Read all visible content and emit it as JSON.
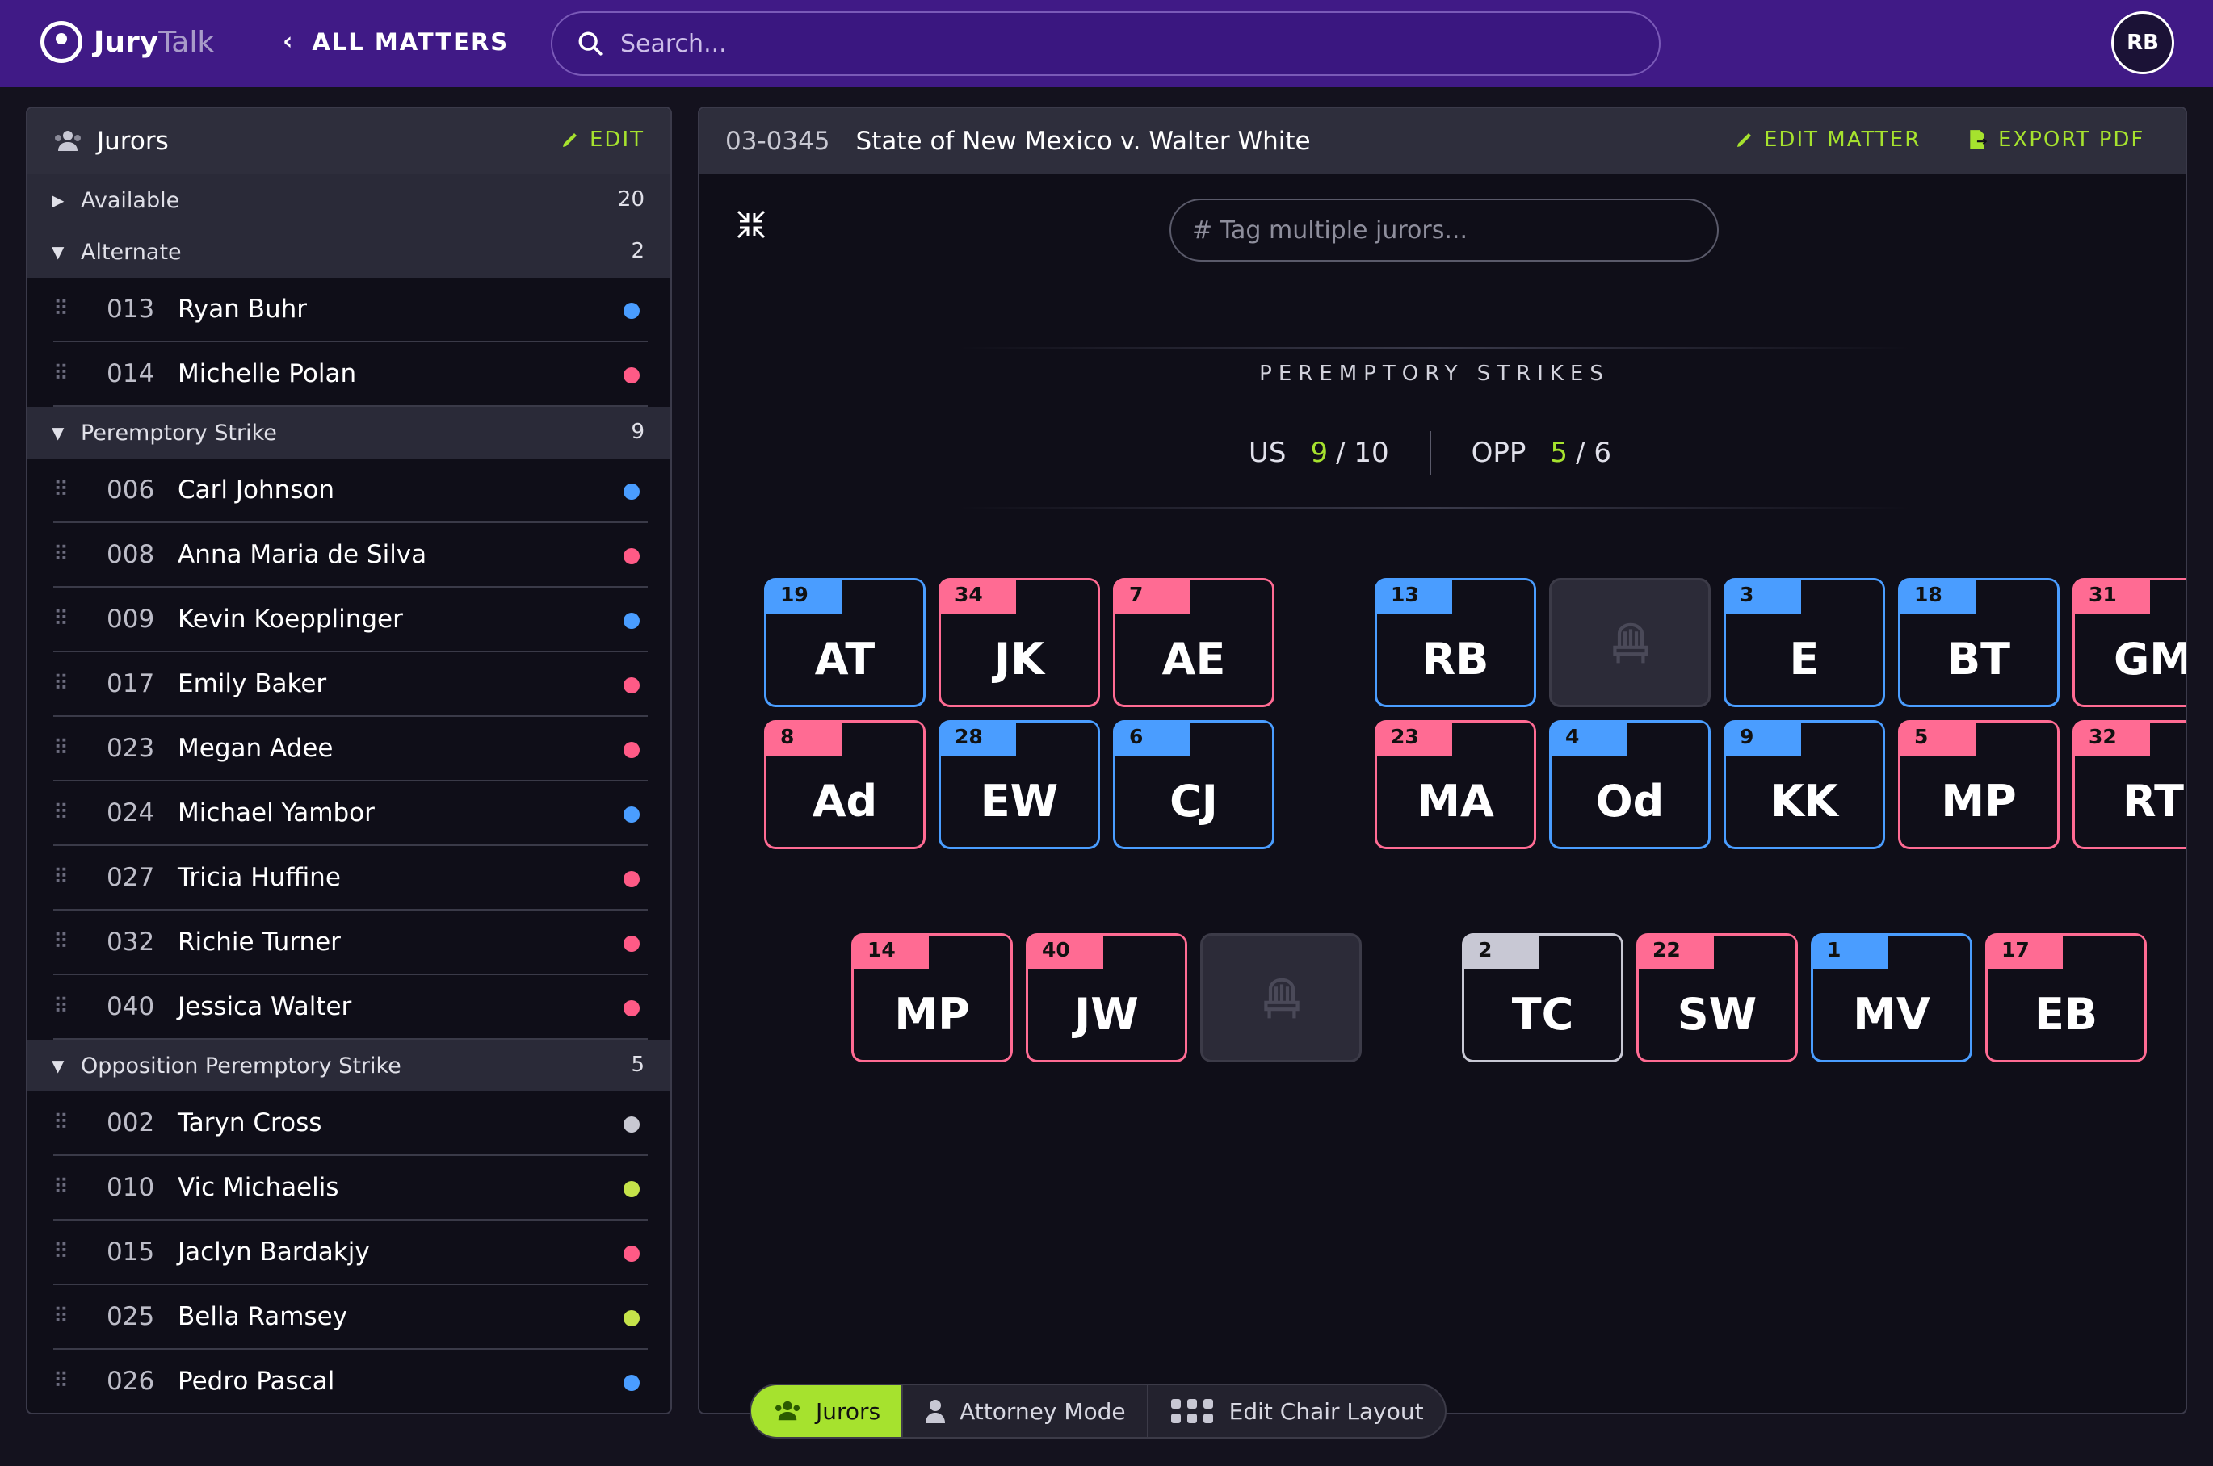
{
  "app": {
    "logo_bold": "Jury",
    "logo_light": "Talk"
  },
  "header": {
    "back_label": "ALL MATTERS",
    "search_placeholder": "Search...",
    "avatar_initials": "RB"
  },
  "sidebar": {
    "title": "Jurors",
    "edit_label": "EDIT",
    "groups": [
      {
        "label": "Available",
        "count": "20",
        "expanded": false
      },
      {
        "label": "Alternate",
        "count": "2",
        "expanded": true
      },
      {
        "label": "Peremptory Strike",
        "count": "9",
        "expanded": true
      },
      {
        "label": "Opposition Peremptory Strike",
        "count": "5",
        "expanded": true
      }
    ],
    "alternate": [
      {
        "num": "013",
        "name": "Ryan Buhr",
        "color": "#4a9dff"
      },
      {
        "num": "014",
        "name": "Michelle Polan",
        "color": "#ff5a86"
      }
    ],
    "peremptory": [
      {
        "num": "006",
        "name": "Carl Johnson",
        "color": "#4a9dff"
      },
      {
        "num": "008",
        "name": "Anna Maria de Silva",
        "color": "#ff5a86"
      },
      {
        "num": "009",
        "name": "Kevin Koepplinger",
        "color": "#4a9dff"
      },
      {
        "num": "017",
        "name": "Emily Baker",
        "color": "#ff5a86"
      },
      {
        "num": "023",
        "name": "Megan Adee",
        "color": "#ff5a86"
      },
      {
        "num": "024",
        "name": "Michael Yambor",
        "color": "#4a9dff"
      },
      {
        "num": "027",
        "name": "Tricia Huffine",
        "color": "#ff5a86"
      },
      {
        "num": "032",
        "name": "Richie Turner",
        "color": "#ff5a86"
      },
      {
        "num": "040",
        "name": "Jessica Walter",
        "color": "#ff5a86"
      }
    ],
    "opposition": [
      {
        "num": "002",
        "name": "Taryn Cross",
        "color": "#c8c8d2"
      },
      {
        "num": "010",
        "name": "Vic Michaelis",
        "color": "#c5e34a"
      },
      {
        "num": "015",
        "name": "Jaclyn Bardakjy",
        "color": "#ff5a86"
      },
      {
        "num": "025",
        "name": "Bella Ramsey",
        "color": "#c5e34a"
      },
      {
        "num": "026",
        "name": "Pedro Pascal",
        "color": "#4a9dff"
      }
    ]
  },
  "matter": {
    "case_number": "03-0345",
    "title": "State of New Mexico v. Walter White",
    "edit_label": "EDIT MATTER",
    "export_label": "EXPORT PDF",
    "tag_placeholder": "# Tag multiple jurors...",
    "strikes_title": "PEREMPTORY STRIKES",
    "us_label": "US",
    "us_used": "9",
    "us_total": "/ 10",
    "opp_label": "OPP",
    "opp_used": "5",
    "opp_total": "/ 6"
  },
  "colors": {
    "blue": "#4a9dff",
    "pink": "#ff6b93",
    "gray": "#c8c8d4",
    "accent": "#a6e22e"
  },
  "chairs": [
    {
      "num": "19",
      "initials": "AT",
      "color": "blue"
    },
    {
      "num": "34",
      "initials": "JK",
      "color": "pink"
    },
    {
      "num": "7",
      "initials": "AE",
      "color": "pink"
    },
    {
      "num": "13",
      "initials": "RB",
      "color": "blue"
    },
    {
      "num": "",
      "initials": "",
      "color": "empty"
    },
    {
      "num": "3",
      "initials": "E",
      "color": "blue"
    },
    {
      "num": "18",
      "initials": "BT",
      "color": "blue"
    },
    {
      "num": "31",
      "initials": "GM",
      "color": "pink"
    },
    {
      "num": "8",
      "initials": "Ad",
      "color": "pink"
    },
    {
      "num": "28",
      "initials": "EW",
      "color": "blue"
    },
    {
      "num": "6",
      "initials": "CJ",
      "color": "blue"
    },
    {
      "num": "23",
      "initials": "MA",
      "color": "pink"
    },
    {
      "num": "4",
      "initials": "Od",
      "color": "blue"
    },
    {
      "num": "9",
      "initials": "KK",
      "color": "blue"
    },
    {
      "num": "5",
      "initials": "MP",
      "color": "pink"
    },
    {
      "num": "32",
      "initials": "RT",
      "color": "pink"
    },
    {
      "num": "14",
      "initials": "MP",
      "color": "pink"
    },
    {
      "num": "40",
      "initials": "JW",
      "color": "pink"
    },
    {
      "num": "",
      "initials": "",
      "color": "empty"
    },
    {
      "num": "2",
      "initials": "TC",
      "color": "gray"
    },
    {
      "num": "22",
      "initials": "SW",
      "color": "pink"
    },
    {
      "num": "1",
      "initials": "MV",
      "color": "blue"
    },
    {
      "num": "17",
      "initials": "EB",
      "color": "pink"
    }
  ],
  "bottom_tabs": [
    {
      "label": "Jurors",
      "active": true
    },
    {
      "label": "Attorney Mode",
      "active": false
    },
    {
      "label": "Edit Chair Layout",
      "active": false
    }
  ]
}
